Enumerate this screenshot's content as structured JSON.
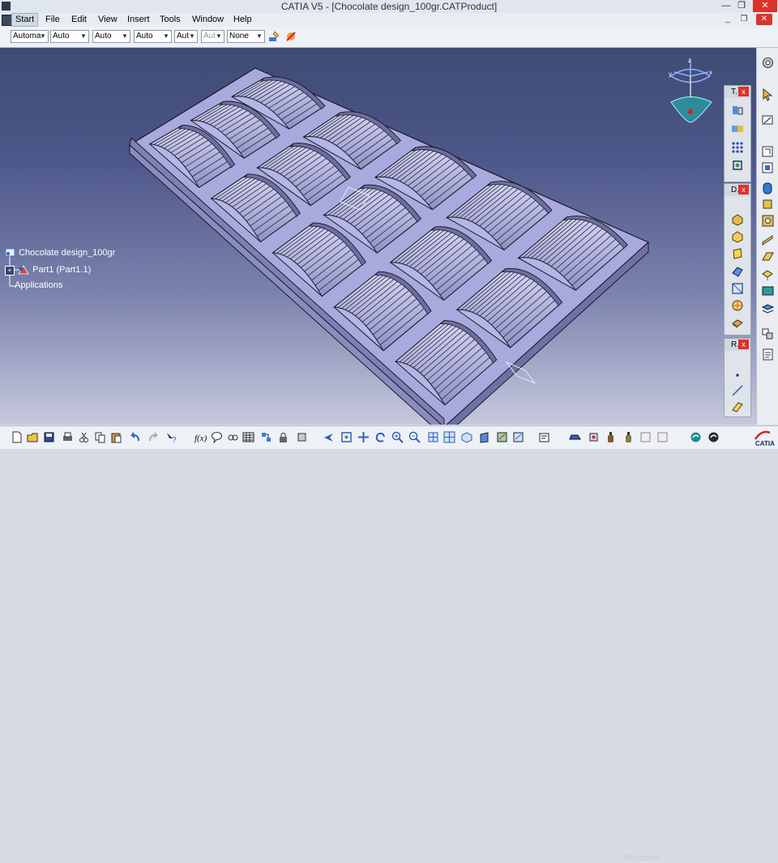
{
  "window": {
    "title": "CATIA V5 - [Chocolate design_100gr.CATProduct]"
  },
  "menu": {
    "items": [
      "Start",
      "File",
      "Edit",
      "View",
      "Insert",
      "Tools",
      "Window",
      "Help"
    ]
  },
  "toolbar": {
    "combos": [
      "Automa",
      "Auto",
      "Auto",
      "Auto",
      "Aut",
      "Aut",
      "None"
    ]
  },
  "tree": {
    "root": "Chocolate design_100gr",
    "part": "Part1 (Part1.1)",
    "applications": "Applications"
  },
  "panels": {
    "tools": "T.",
    "dress": "D.",
    "render": "R."
  },
  "compass": {
    "x": "x",
    "y": "y",
    "z": "z"
  },
  "watermark": "Windows",
  "logo": "CATIA",
  "colors": {
    "viewport_top": "#3f4a74",
    "viewport_bottom": "#c6c9dc",
    "model": "#b7b9ea",
    "accent_close": "#d9342b"
  }
}
